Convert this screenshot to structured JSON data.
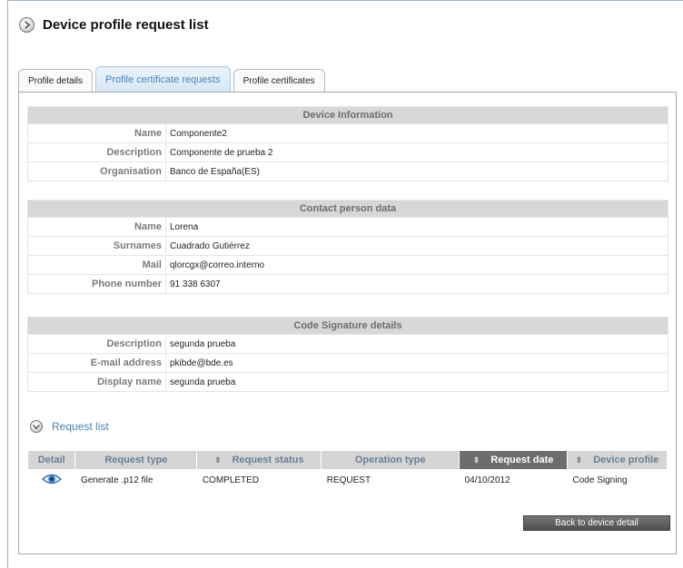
{
  "page": {
    "title": "Device profile request list"
  },
  "tabs": [
    {
      "label": "Profile details"
    },
    {
      "label": "Profile certificate requests"
    },
    {
      "label": "Profile certificates"
    }
  ],
  "device_info": {
    "heading": "Device Information",
    "rows": [
      {
        "label": "Name",
        "value": "Componente2"
      },
      {
        "label": "Description",
        "value": "Componente de prueba 2"
      },
      {
        "label": "Organisation",
        "value": "Banco de España(ES)"
      }
    ]
  },
  "contact_person": {
    "heading": "Contact person data",
    "rows": [
      {
        "label": "Name",
        "value": "Lorena"
      },
      {
        "label": "Surnames",
        "value": "Cuadrado Gutiérrez"
      },
      {
        "label": "Mail",
        "value": "qlorcgx@correo.interno"
      },
      {
        "label": "Phone number",
        "value": "91 338 6307"
      }
    ]
  },
  "code_signature": {
    "heading": "Code Signature details",
    "rows": [
      {
        "label": "Description",
        "value": "segunda prueba"
      },
      {
        "label": "E-mail address",
        "value": "pkibde@bde.es"
      },
      {
        "label": "Display name",
        "value": "segunda prueba"
      }
    ]
  },
  "request_list": {
    "title": "Request list",
    "columns": [
      "Detail",
      "Request type",
      "Request status",
      "Operation type",
      "Request date",
      "Device profile"
    ],
    "rows": [
      {
        "type": "Generate .p12 file",
        "status": "COMPLETED",
        "operation": "REQUEST",
        "date": "04/10/2012",
        "profile": "Code Signing"
      }
    ]
  },
  "actions": {
    "back_label": "Back to device detail"
  },
  "icons": {
    "header": "back-circle-icon",
    "section": "collapse-circle-icon",
    "detail": "eye-icon"
  }
}
